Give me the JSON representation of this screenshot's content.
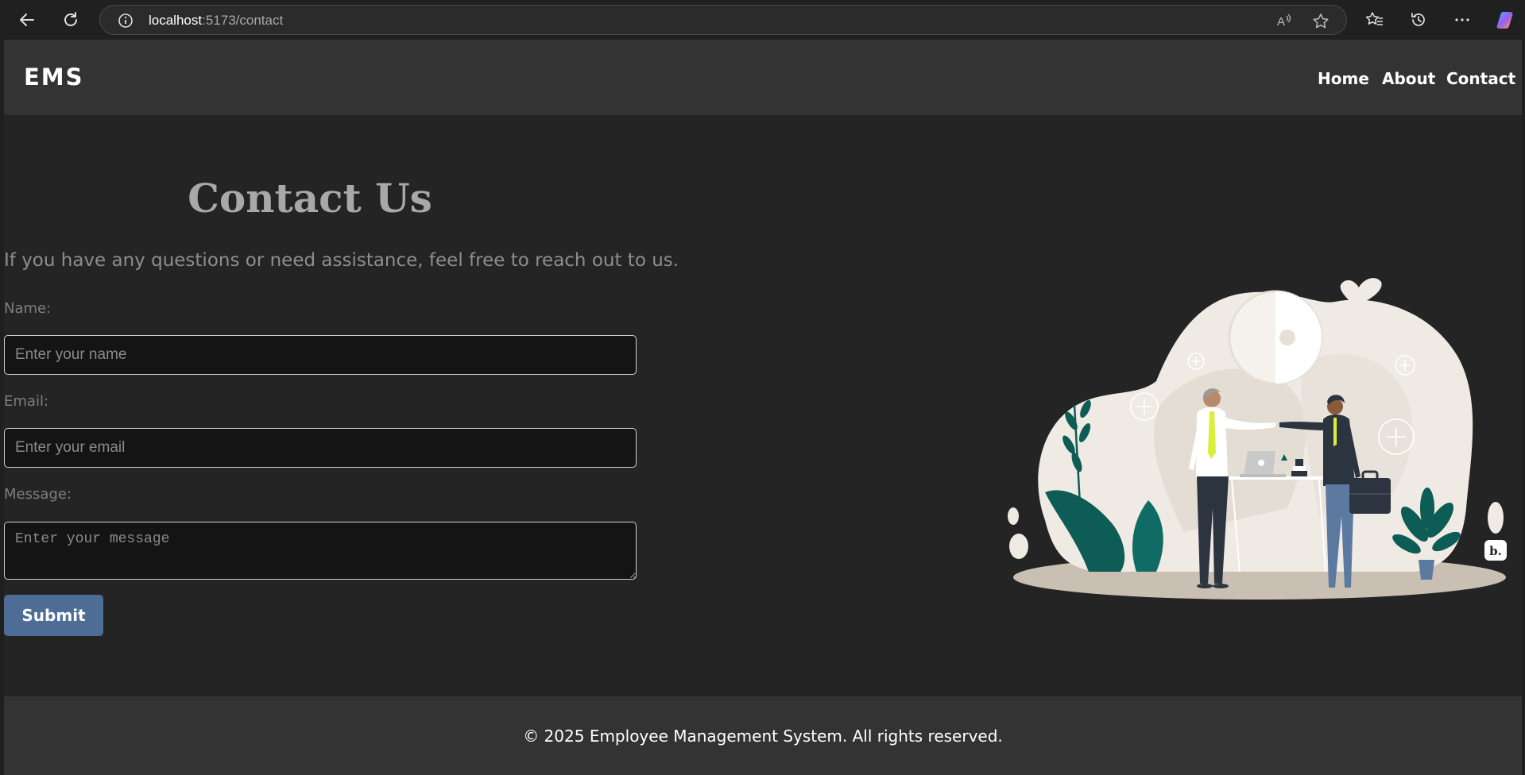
{
  "browser": {
    "url_host": "localhost",
    "url_path": ":5173/contact"
  },
  "navbar": {
    "logo": "EMS",
    "links": [
      {
        "label": "Home"
      },
      {
        "label": "About"
      },
      {
        "label": "Contact"
      }
    ]
  },
  "contact": {
    "title": "Contact Us",
    "lead": "If you have any questions or need assistance, feel free to reach out to us.",
    "name_label": "Name:",
    "name_placeholder": "Enter your name",
    "email_label": "Email:",
    "email_placeholder": "Enter your email",
    "message_label": "Message:",
    "message_placeholder": "Enter your message",
    "submit_label": "Submit"
  },
  "illustration": {
    "badge": "b."
  },
  "footer": {
    "text": "© 2025 Employee Management System. All rights reserved."
  },
  "colors": {
    "page_bg": "#242424",
    "navbar_bg": "#333333",
    "button_bg": "#4d6d96",
    "accent_green": "#0d5c55",
    "tie_yellow": "#d8f03a"
  }
}
